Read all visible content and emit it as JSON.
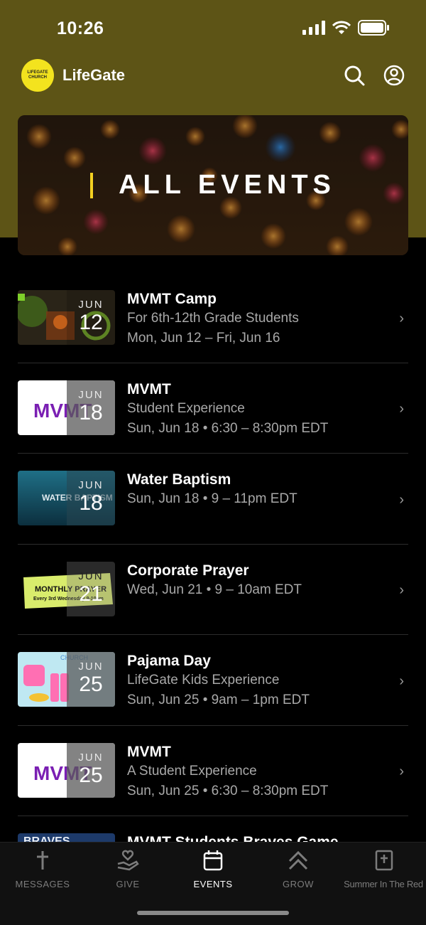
{
  "status_bar": {
    "time": "10:26"
  },
  "header": {
    "app_name": "LifeGate",
    "logo_text": "LIFEGATE CHURCH",
    "icons": [
      "search-icon",
      "profile-icon"
    ]
  },
  "banner": {
    "title": "ALL EVENTS"
  },
  "events": [
    {
      "title": "MVMT Camp",
      "line1": "For 6th-12th Grade Students",
      "line2": "Mon, Jun 12 – Fri, Jun 16",
      "month": "JUN",
      "day": "12"
    },
    {
      "title": "MVMT",
      "line1": "Student Experience",
      "line2": "Sun, Jun 18 • 6:30 – 8:30pm EDT",
      "month": "JUN",
      "day": "18",
      "thumb_text": "MVMT"
    },
    {
      "title": "Water Baptism",
      "line1": "Sun, Jun 18 • 9 – 11pm EDT",
      "line2": "",
      "month": "JUN",
      "day": "18",
      "thumb_text": "WATER BAPTISM"
    },
    {
      "title": "Corporate Prayer",
      "line1": "Wed, Jun 21 • 9 – 10am EDT",
      "line2": "",
      "month": "JUN",
      "day": "21",
      "thumb_text": "MONTHLY PRAYER",
      "thumb_sub": "Every 3rd Wednesday 9-10am"
    },
    {
      "title": "Pajama Day",
      "line1": "LifeGate Kids Experience",
      "line2": "Sun, Jun 25 • 9am – 1pm EDT",
      "month": "JUN",
      "day": "25",
      "thumb_text": "CHURCH"
    },
    {
      "title": "MVMT",
      "line1": "A Student Experience",
      "line2": "Sun, Jun 25 • 6:30 – 8:30pm EDT",
      "month": "JUN",
      "day": "25",
      "thumb_text": "MVMT"
    },
    {
      "title": "MVMT Students Braves Game",
      "line1": "",
      "line2": "",
      "month": "",
      "day": "",
      "thumb_text": "BRAVES"
    }
  ],
  "tabs": [
    {
      "label": "MESSAGES",
      "icon": "cross-icon",
      "active": false
    },
    {
      "label": "GIVE",
      "icon": "give-heart-icon",
      "active": false
    },
    {
      "label": "EVENTS",
      "icon": "calendar-icon",
      "active": true
    },
    {
      "label": "GROW",
      "icon": "chevrons-up-icon",
      "active": false
    },
    {
      "label": "Summer In The Red",
      "icon": "bible-icon",
      "active": false
    }
  ],
  "colors": {
    "header_bg": "#5d5416",
    "accent_yellow": "#f3d021",
    "logo_yellow": "#f3e31e"
  }
}
